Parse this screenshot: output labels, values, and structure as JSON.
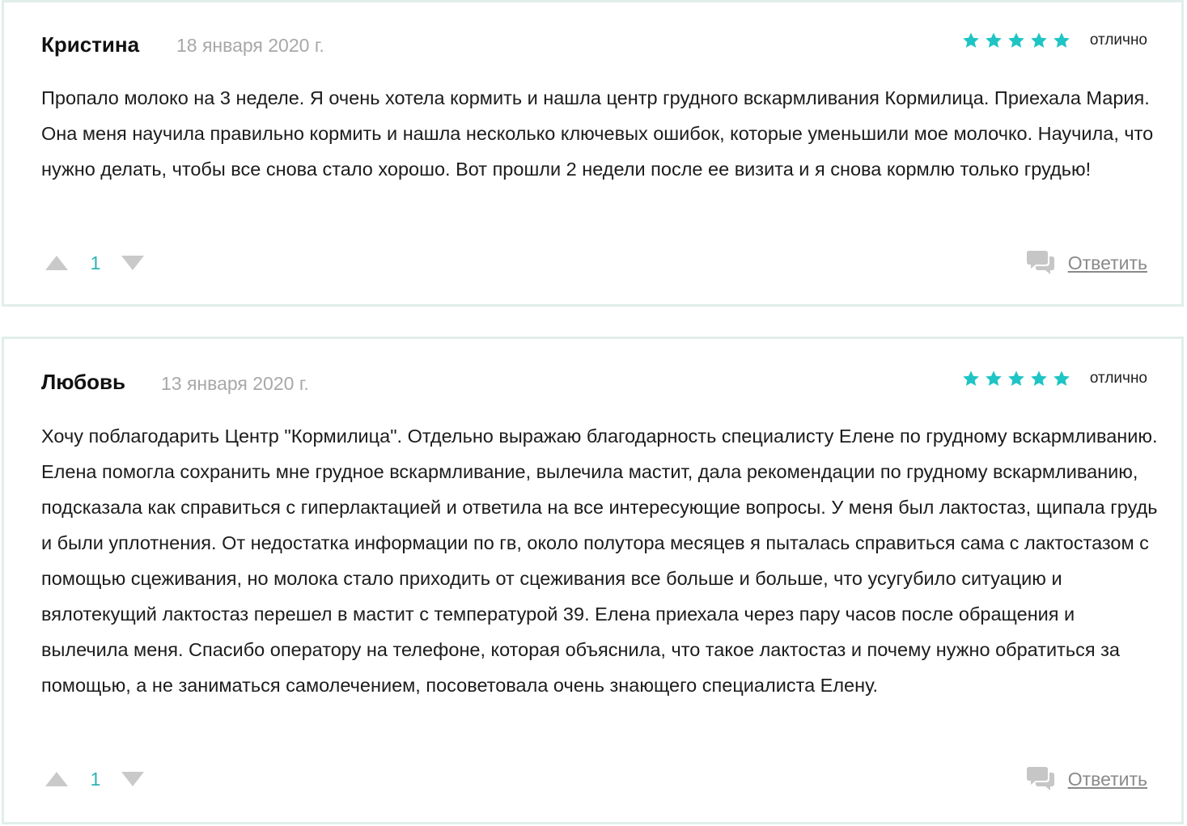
{
  "reviews": [
    {
      "author": "Кристина",
      "date": "18 января 2020 г.",
      "stars": 5,
      "rating_label": "отлично",
      "text": "Пропало молоко на 3 неделе. Я очень хотела кормить и нашла центр грудного вскармливания Кормилица. Приехала Мария. Она меня научила правильно кормить и нашла несколько ключевых ошибок, которые уменьшили мое молочко. Научила, что нужно делать, чтобы все снова стало хорошо. Вот прошли 2 недели после ее визита и я снова кормлю только грудью!",
      "votes": "1",
      "reply_label": "Ответить"
    },
    {
      "author": "Любовь",
      "date": "13 января 2020 г.",
      "stars": 5,
      "rating_label": "отлично",
      "text": "Хочу поблагодарить Центр \"Кормилица\". Отдельно выражаю благодарность специалисту Елене по грудному вскармливанию. Елена помогла сохранить мне грудное вскармливание, вылечила мастит, дала рекомендации по грудному вскармливанию, подсказала как справиться с гиперлактацией и ответила на все интересующие вопросы. У меня был лактостаз, щипала грудь и были уплотнения. От недостатка информации по гв, около полутора месяцев я пыталась справиться сама с лактостазом с помощью сцеживания, но молока стало приходить от сцеживания все больше и больше, что усугубило ситуацию и вялотекущий лактостаз перешел в мастит с температурой 39. Елена приехала через пару часов после обращения и вылечила меня. Спасибо оператору на телефоне, которая объяснила, что такое лактостаз и почему нужно обратиться за помощью, а не заниматься самолечением, посоветовала очень знающего специалиста Елену.",
      "votes": "1",
      "reply_label": "Ответить"
    }
  ],
  "icons": {
    "star": "star-icon",
    "vote_up": "triangle-up-icon",
    "vote_down": "triangle-down-icon",
    "reply": "speech-bubbles-icon"
  },
  "colors": {
    "star": "#1fc4c4",
    "vote_count": "#2cb3b3",
    "vote_arrow": "#c9c9c9",
    "reply_icon": "#c6c6c6",
    "border": "#e1eeeb",
    "date": "#a8a8a8"
  }
}
